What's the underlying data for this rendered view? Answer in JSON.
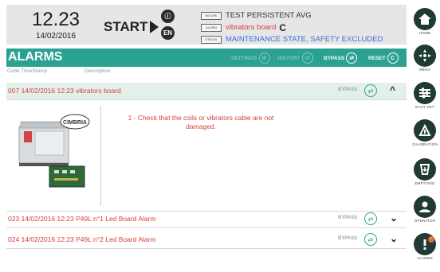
{
  "header": {
    "time": "12.23",
    "date": "14/02/2016",
    "start_label": "START",
    "lang_label": "EN",
    "status_rows": [
      {
        "tag": "RECIPE",
        "value": "TEST PERSISTENT AVG"
      },
      {
        "tag": "ALARM",
        "value": "vibrators board"
      },
      {
        "tag": "STATUS",
        "value": "MAINTENANCE STATE, SAFETY EXCLUDED"
      }
    ]
  },
  "titlebar": {
    "title": "ALARMS",
    "settings_label": "SETTINGS",
    "history_label": "HISTORY",
    "bypass_label": "BYPASS",
    "reset_label": "RESET"
  },
  "columns": {
    "code_ts": "Code TimeStamp",
    "description": "Description"
  },
  "alarms": [
    {
      "code": "007",
      "timestamp": "14/02/2016 12:23",
      "description": "vibrators board",
      "bypass_label": "BYPASS",
      "expanded": true
    },
    {
      "code": "023",
      "timestamp": "14/02/2016 12:23",
      "description": "P49L n°1 Led Board Alarm",
      "bypass_label": "BYPASS",
      "expanded": false
    },
    {
      "code": "024",
      "timestamp": "14/02/2016 12:23",
      "description": "P49L n°2 Led Board Alarm",
      "bypass_label": "BYPASS",
      "expanded": false
    }
  ],
  "detail": {
    "message": "1 - Check that the coils or vibrators cable are not damaged.",
    "logo_text": "CIMBRIA"
  },
  "sidebar": [
    {
      "label": "HOME",
      "icon": "home-icon"
    },
    {
      "label": "MENU",
      "icon": "menu-icon"
    },
    {
      "label": "EASY SET",
      "icon": "sliders-icon"
    },
    {
      "label": "CALIBRATION",
      "icon": "calibration-icon"
    },
    {
      "label": "EMPTYING",
      "icon": "emptying-icon"
    },
    {
      "label": "OPERATOR",
      "icon": "operator-icon"
    },
    {
      "label": "ALARMS",
      "icon": "alarm-icon",
      "badge": "!"
    }
  ],
  "colors": {
    "accent": "#2aa191",
    "alarm": "#d9403a",
    "status": "#3a6fd4",
    "sidebar_icon": "#1f3a33"
  }
}
